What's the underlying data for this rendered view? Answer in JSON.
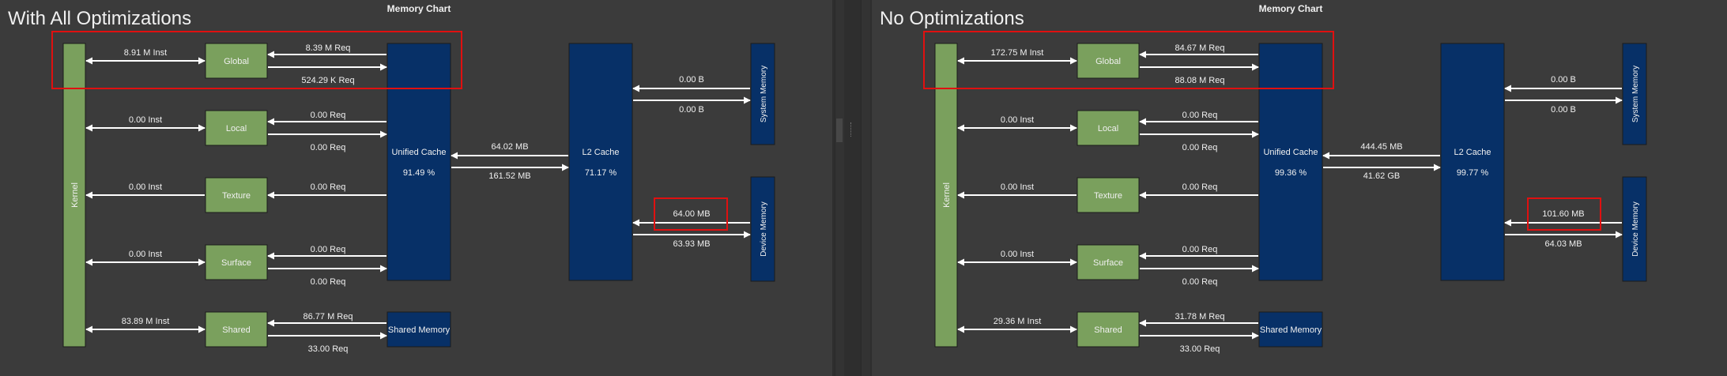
{
  "colors": {
    "background": "#3b3b3b",
    "gutter": "#2e2e2e",
    "green_box": "#7aa05d",
    "blue_box": "#073067",
    "arrow": "#ffffff",
    "highlight_red": "#e01010",
    "text": "#f0f0f0"
  },
  "panels": [
    {
      "overlay_label": "With All Optimizations",
      "title": "Memory Chart",
      "kernel": "Kernel",
      "blocks": [
        "Global",
        "Local",
        "Texture",
        "Surface",
        "Shared"
      ],
      "inst": [
        "8.91 M Inst",
        "0.00 Inst",
        "0.00 Inst",
        "0.00 Inst",
        "83.89 M Inst"
      ],
      "req_in": [
        "8.39 M Req",
        "0.00 Req",
        "0.00 Req",
        "0.00 Req",
        "86.77 M Req"
      ],
      "req_out": [
        "524.29 K Req",
        "0.00 Req",
        "",
        "0.00 Req",
        "33.00 Req"
      ],
      "unified_cache": {
        "label": "Unified Cache",
        "hit_rate": "91.49 %"
      },
      "shared_memory": "Shared Memory",
      "uc_l2_read": "64.02 MB",
      "uc_l2_write": "161.52 MB",
      "l2_cache": {
        "label": "L2 Cache",
        "hit_rate": "71.17 %"
      },
      "system_memory": {
        "label": "System Memory",
        "read": "0.00 B",
        "write": "0.00 B"
      },
      "device_memory": {
        "label": "Device Memory",
        "read": "64.00 MB",
        "write": "63.93 MB"
      }
    },
    {
      "overlay_label": "No Optimizations",
      "title": "Memory Chart",
      "kernel": "Kernel",
      "blocks": [
        "Global",
        "Local",
        "Texture",
        "Surface",
        "Shared"
      ],
      "inst": [
        "172.75 M Inst",
        "0.00 Inst",
        "0.00 Inst",
        "0.00 Inst",
        "29.36 M Inst"
      ],
      "req_in": [
        "84.67 M Req",
        "0.00 Req",
        "0.00 Req",
        "0.00 Req",
        "31.78 M Req"
      ],
      "req_out": [
        "88.08 M Req",
        "0.00 Req",
        "",
        "0.00 Req",
        "33.00 Req"
      ],
      "unified_cache": {
        "label": "Unified Cache",
        "hit_rate": "99.36 %"
      },
      "shared_memory": "Shared Memory",
      "uc_l2_read": "444.45 MB",
      "uc_l2_write": "41.62 GB",
      "l2_cache": {
        "label": "L2 Cache",
        "hit_rate": "99.77 %"
      },
      "system_memory": {
        "label": "System Memory",
        "read": "0.00 B",
        "write": "0.00 B"
      },
      "device_memory": {
        "label": "Device Memory",
        "read": "101.60 MB",
        "write": "64.03 MB"
      }
    }
  ]
}
